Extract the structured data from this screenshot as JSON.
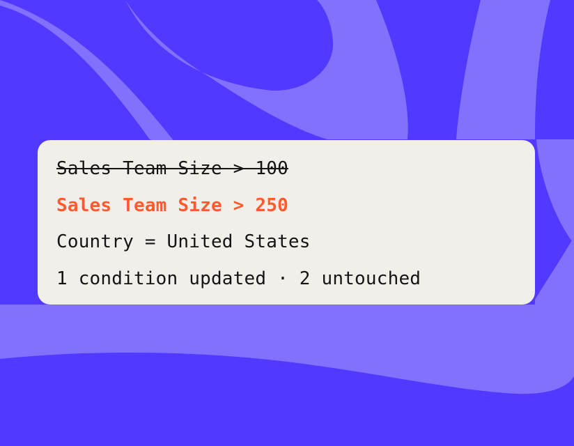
{
  "colors": {
    "background": "#5139FF",
    "wave": "#8270FF",
    "card_background": "#F2EFEB",
    "text": "#141414",
    "highlight": "#FF5B2E"
  },
  "conditions": {
    "previous": "Sales Team Size > 100",
    "updated": "Sales Team Size > 250",
    "unchanged": "Country = United States"
  },
  "summary": "1 condition updated · 2 untouched"
}
